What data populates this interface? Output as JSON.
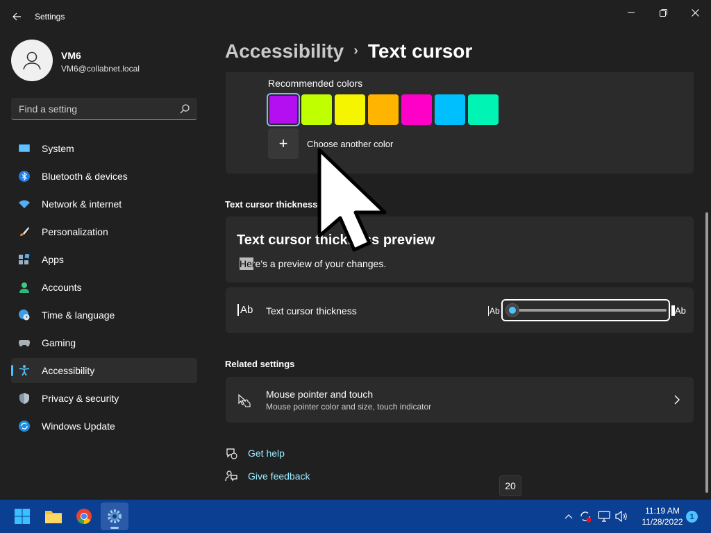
{
  "titlebar": {
    "app_title": "Settings"
  },
  "profile": {
    "name": "VM6",
    "email": "VM6@collabnet.local"
  },
  "search": {
    "placeholder": "Find a setting"
  },
  "sidebar": {
    "items": [
      {
        "label": "System",
        "icon": "monitor-icon",
        "active": false
      },
      {
        "label": "Bluetooth & devices",
        "icon": "bluetooth-icon",
        "active": false
      },
      {
        "label": "Network & internet",
        "icon": "wifi-icon",
        "active": false
      },
      {
        "label": "Personalization",
        "icon": "brush-icon",
        "active": false
      },
      {
        "label": "Apps",
        "icon": "apps-icon",
        "active": false
      },
      {
        "label": "Accounts",
        "icon": "person-icon",
        "active": false
      },
      {
        "label": "Time & language",
        "icon": "globe-clock-icon",
        "active": false
      },
      {
        "label": "Gaming",
        "icon": "gamepad-icon",
        "active": false
      },
      {
        "label": "Accessibility",
        "icon": "accessibility-icon",
        "active": true
      },
      {
        "label": "Privacy & security",
        "icon": "shield-icon",
        "active": false
      },
      {
        "label": "Windows Update",
        "icon": "update-icon",
        "active": false
      }
    ]
  },
  "breadcrumb": {
    "parent": "Accessibility",
    "separator": "›",
    "current": "Text cursor"
  },
  "colors": {
    "label": "Recommended colors",
    "swatches": [
      "#b40ff0",
      "#c0ff00",
      "#f5f500",
      "#ffb400",
      "#ff00c8",
      "#00bfff",
      "#00f5b4"
    ],
    "selected_index": 0,
    "add_symbol": "+",
    "choose_label": "Choose another color"
  },
  "thickness_section": {
    "title": "Text cursor thickness"
  },
  "preview": {
    "title": "Text cursor thickness preview",
    "text": "Here's a preview of your changes."
  },
  "thickness": {
    "icon_text": "Ab",
    "label": "Text cursor thickness",
    "min_label": "Ab",
    "max_label": "Ab",
    "value": 1,
    "min": 1,
    "max": 20
  },
  "related": {
    "title": "Related settings",
    "item_title": "Mouse pointer and touch",
    "item_subtitle": "Mouse pointer color and size, touch indicator"
  },
  "links": {
    "help": "Get help",
    "feedback": "Give feedback"
  },
  "tooltip": {
    "value": "20"
  },
  "taskbar": {
    "time": "11:19 AM",
    "date": "11/28/2022",
    "notification_count": "1"
  },
  "theme": {
    "accent": "#4cc2ff",
    "taskbar": "#0b3f91",
    "link": "#99ebff"
  }
}
